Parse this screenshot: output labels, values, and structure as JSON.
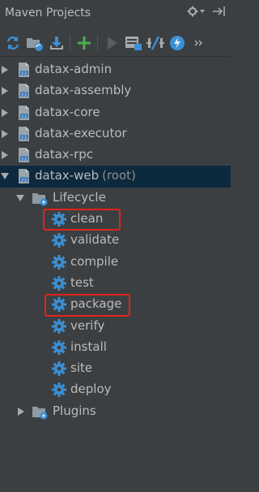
{
  "panel": {
    "title": "Maven Projects",
    "settings_icon": "gear-icon",
    "hide_icon": "hide-panel-icon"
  },
  "toolbar": {
    "icons": [
      "reimport-icon",
      "generate-sources-icon",
      "download-icon",
      "add-icon",
      "run-icon",
      "execute-goal-icon",
      "toggle-offline-icon",
      "skip-tests-icon",
      "more-icon"
    ]
  },
  "tree": {
    "projects": [
      {
        "label": "datax-admin"
      },
      {
        "label": "datax-assembly"
      },
      {
        "label": "datax-core"
      },
      {
        "label": "datax-executor"
      },
      {
        "label": "datax-rpc"
      },
      {
        "label": "datax-web",
        "suffix": "(root)"
      }
    ],
    "lifecycle": {
      "label": "Lifecycle",
      "goals": [
        "clean",
        "validate",
        "compile",
        "test",
        "package",
        "verify",
        "install",
        "site",
        "deploy"
      ]
    },
    "plugins": {
      "label": "Plugins"
    }
  },
  "colors": {
    "background": "#3c3f41",
    "selection": "#0d293e",
    "highlight": "#e0241a",
    "gear": "#3b8fd4"
  }
}
